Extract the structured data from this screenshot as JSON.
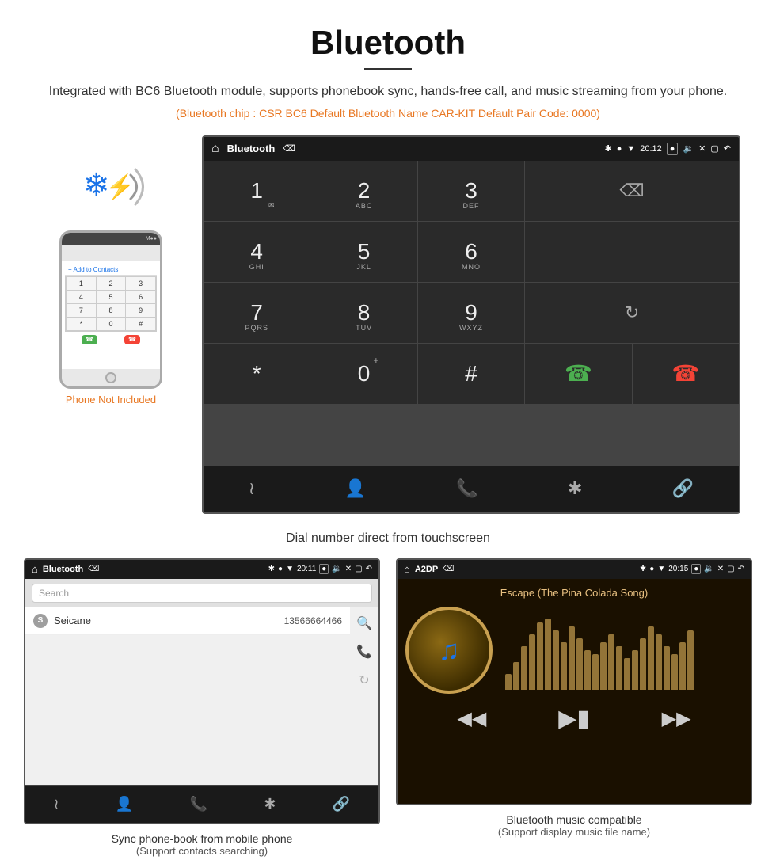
{
  "header": {
    "title": "Bluetooth",
    "description": "Integrated with BC6 Bluetooth module, supports phonebook sync, hands-free call, and music streaming from your phone.",
    "specs": "(Bluetooth chip : CSR BC6    Default Bluetooth Name CAR-KIT    Default Pair Code: 0000)"
  },
  "phone_graphic": {
    "not_included": "Phone Not Included",
    "add_to_contacts": "+ Add to Contacts"
  },
  "android_dial": {
    "statusbar": {
      "title": "Bluetooth",
      "time": "20:12"
    },
    "keys": [
      {
        "num": "1",
        "sub": ""
      },
      {
        "num": "2",
        "sub": "ABC"
      },
      {
        "num": "3",
        "sub": "DEF"
      },
      {
        "num": "4",
        "sub": "GHI"
      },
      {
        "num": "5",
        "sub": "JKL"
      },
      {
        "num": "6",
        "sub": "MNO"
      },
      {
        "num": "7",
        "sub": "PQRS"
      },
      {
        "num": "8",
        "sub": "TUV"
      },
      {
        "num": "9",
        "sub": "WXYZ"
      },
      {
        "num": "*",
        "sub": ""
      },
      {
        "num": "0",
        "sub": "+"
      },
      {
        "num": "#",
        "sub": ""
      }
    ]
  },
  "dial_caption": "Dial number direct from touchscreen",
  "phonebook_screen": {
    "statusbar_title": "Bluetooth",
    "time": "20:11",
    "search_placeholder": "Search",
    "contacts": [
      {
        "initial": "S",
        "name": "Seicane",
        "number": "13566664466"
      }
    ]
  },
  "music_screen": {
    "statusbar_title": "A2DP",
    "time": "20:15",
    "song_title": "Escape (The Pina Colada Song)"
  },
  "bottom_captions": {
    "phonebook_main": "Sync phone-book from mobile phone",
    "phonebook_sub": "(Support contacts searching)",
    "music_main": "Bluetooth music compatible",
    "music_sub": "(Support display music file name)"
  },
  "eq_bars": [
    20,
    35,
    55,
    70,
    85,
    90,
    75,
    60,
    80,
    65,
    50,
    45,
    60,
    70,
    55,
    40,
    50,
    65,
    80,
    70,
    55,
    45,
    60,
    75
  ]
}
